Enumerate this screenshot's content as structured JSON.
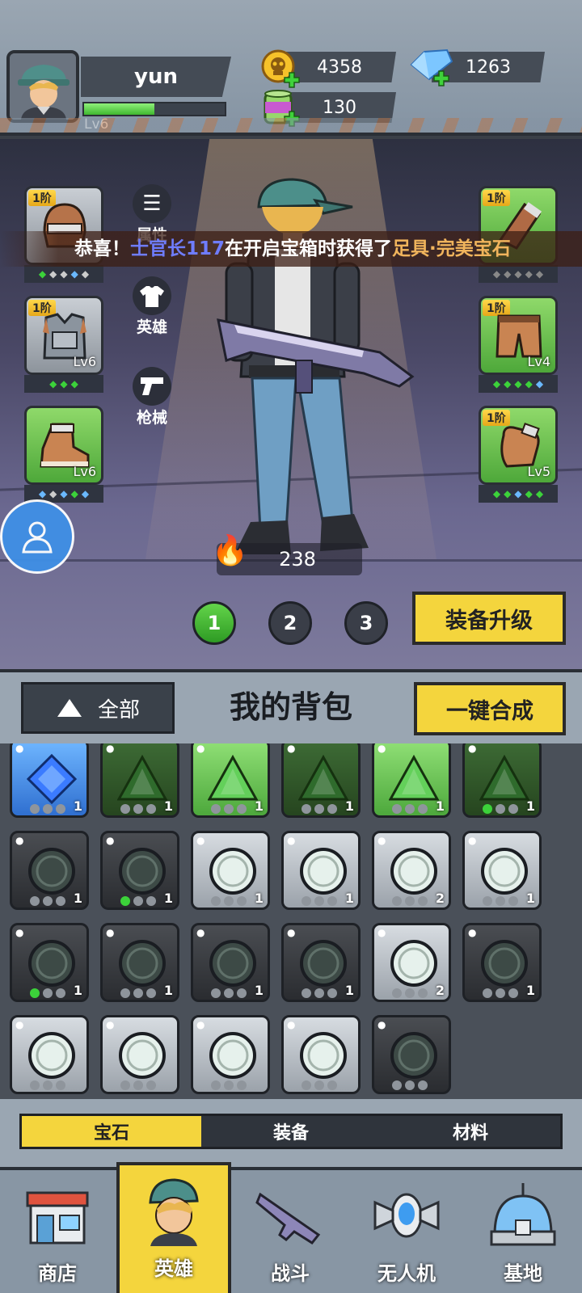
{
  "player": {
    "name": "yun",
    "level": "Lv6",
    "xp_fraction": 0.5
  },
  "resources": {
    "gold": "4358",
    "diamond": "1263",
    "energy": "130"
  },
  "hero": {
    "side_buttons": [
      "属性",
      "英雄",
      "枪械"
    ],
    "power": "238",
    "notice": {
      "prefix": "恭喜！",
      "player": "士官长117",
      "middle": "在开启宝箱时获得了",
      "item": "足具·完美宝石"
    },
    "pages": [
      "1",
      "2",
      "3"
    ],
    "upgrade_label": "装备升级",
    "equipment": [
      {
        "tier": "1阶",
        "level": "",
        "color": "grey"
      },
      {
        "tier": "1阶",
        "level": "Lv6",
        "color": "grey"
      },
      {
        "tier": "",
        "level": "Lv6",
        "color": "green"
      },
      {
        "tier": "1阶",
        "level": "",
        "color": "green"
      },
      {
        "tier": "1阶",
        "level": "Lv4",
        "color": "green"
      },
      {
        "tier": "1阶",
        "level": "Lv5",
        "color": "green"
      }
    ]
  },
  "bag": {
    "title": "我的背包",
    "filter_label": "全部",
    "merge_label": "一键合成",
    "items": [
      {
        "style": "blue",
        "count": "1",
        "active": 0
      },
      {
        "style": "dgreen",
        "count": "1",
        "active": 0
      },
      {
        "style": "lgreen",
        "count": "1",
        "active": 0
      },
      {
        "style": "dgreen",
        "count": "1",
        "active": 0
      },
      {
        "style": "lgreen",
        "count": "1",
        "active": 0
      },
      {
        "style": "dgreen",
        "count": "1",
        "active": 1
      },
      {
        "style": "dark",
        "count": "1",
        "active": 0
      },
      {
        "style": "dark",
        "count": "1",
        "active": 1
      },
      {
        "style": "light",
        "count": "1",
        "active": 0
      },
      {
        "style": "light",
        "count": "1",
        "active": 0
      },
      {
        "style": "light",
        "count": "2",
        "active": 0
      },
      {
        "style": "light",
        "count": "1",
        "active": 0
      },
      {
        "style": "dark",
        "count": "1",
        "active": 1
      },
      {
        "style": "dark",
        "count": "1",
        "active": 0
      },
      {
        "style": "dark",
        "count": "1",
        "active": 0
      },
      {
        "style": "dark",
        "count": "1",
        "active": 0
      },
      {
        "style": "light",
        "count": "2",
        "active": 0
      },
      {
        "style": "dark",
        "count": "1",
        "active": 0
      },
      {
        "style": "light",
        "count": "",
        "active": 0
      },
      {
        "style": "light",
        "count": "",
        "active": 0
      },
      {
        "style": "light",
        "count": "",
        "active": 0
      },
      {
        "style": "light",
        "count": "",
        "active": 0
      },
      {
        "style": "dark",
        "count": "",
        "active": 0
      }
    ],
    "tabs": [
      "宝石",
      "装备",
      "材料"
    ],
    "active_tab": 0
  },
  "nav": {
    "items": [
      "商店",
      "英雄",
      "战斗",
      "无人机",
      "基地"
    ],
    "active": 1
  },
  "colors": {
    "accent_yellow": "#f4d53d",
    "green": "#3fb82f",
    "notice_player": "#6f7dff",
    "notice_item": "#f0b45c"
  }
}
